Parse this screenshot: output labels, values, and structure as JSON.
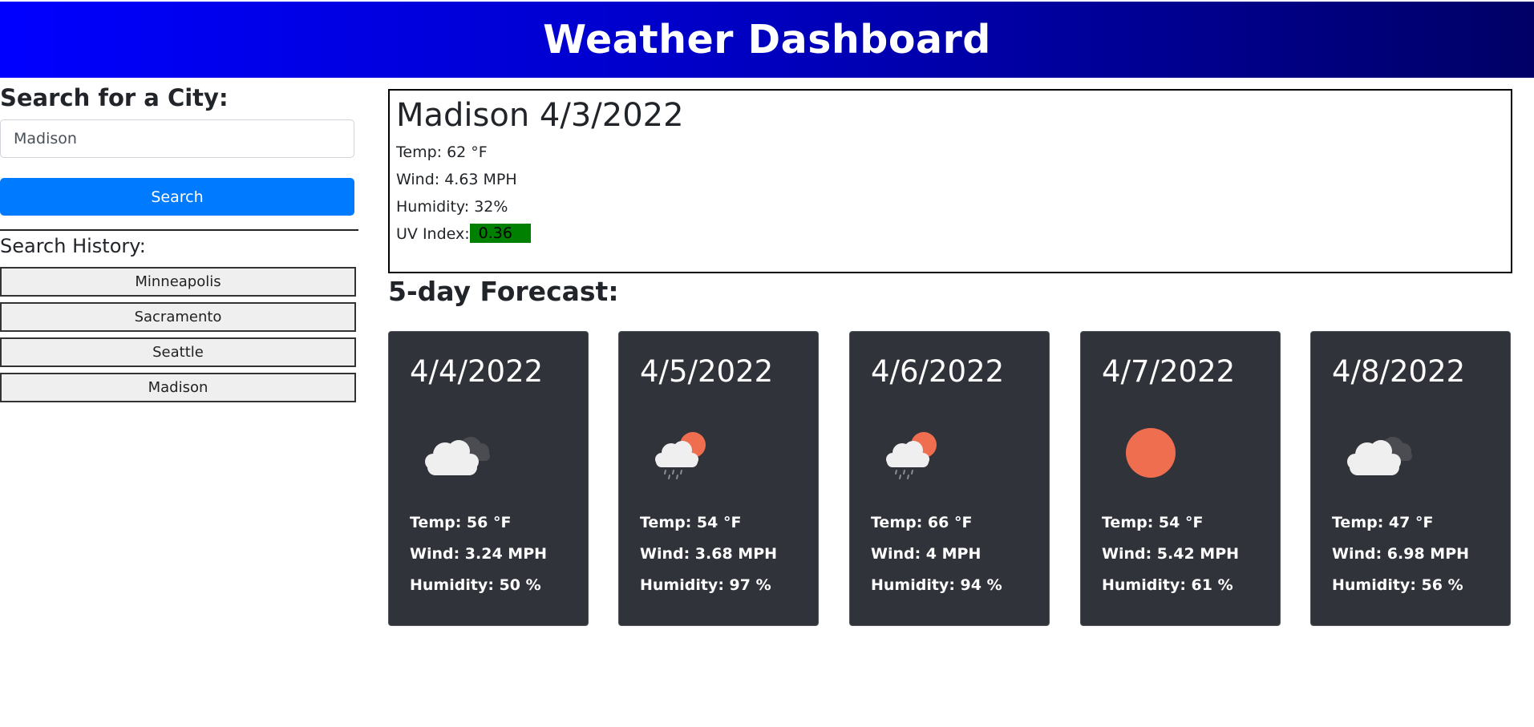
{
  "header": {
    "title": "Weather Dashboard"
  },
  "sidebar": {
    "search_heading": "Search for a City:",
    "input_value": "Madison",
    "search_button": "Search",
    "history_heading": "Search History:",
    "history": [
      "Minneapolis",
      "Sacramento",
      "Seattle",
      "Madison"
    ]
  },
  "current": {
    "title": "Madison 4/3/2022",
    "temp": "Temp: 62 °F",
    "wind": "Wind: 4.63 MPH",
    "humidity": "Humidity: 32%",
    "uv_label": "UV Index:",
    "uv_value": "0.36",
    "uv_color": "#008000"
  },
  "forecast": {
    "heading": "5-day Forecast:",
    "days": [
      {
        "date": "4/4/2022",
        "icon": "cloud-overcast-icon",
        "temp": "Temp: 56 °F",
        "wind": "Wind: 3.24 MPH",
        "humidity": "Humidity: 50 %"
      },
      {
        "date": "4/5/2022",
        "icon": "sun-rain-cloud-icon",
        "temp": "Temp: 54 °F",
        "wind": "Wind: 3.68 MPH",
        "humidity": "Humidity: 97 %"
      },
      {
        "date": "4/6/2022",
        "icon": "sun-rain-cloud-icon",
        "temp": "Temp: 66 °F",
        "wind": "Wind: 4 MPH",
        "humidity": "Humidity: 94 %"
      },
      {
        "date": "4/7/2022",
        "icon": "sun-icon",
        "temp": "Temp: 54 °F",
        "wind": "Wind: 5.42 MPH",
        "humidity": "Humidity: 61 %"
      },
      {
        "date": "4/8/2022",
        "icon": "cloud-overcast-icon",
        "temp": "Temp: 47 °F",
        "wind": "Wind: 6.98 MPH",
        "humidity": "Humidity: 56 %"
      }
    ]
  },
  "colors": {
    "header_start": "#0000ff",
    "header_end": "#000066",
    "search_button": "#007bff",
    "card_bg": "#31333a",
    "sun": "#ee6e4f"
  }
}
